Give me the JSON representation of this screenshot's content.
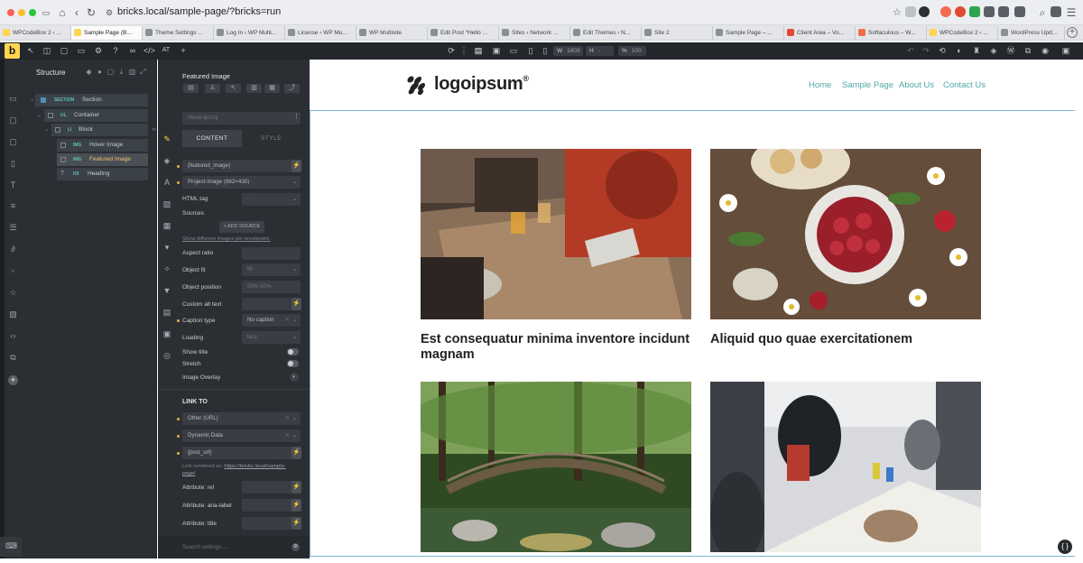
{
  "browser": {
    "url": "bricks.local/sample-page/?bricks=run",
    "tabs": [
      "WPCodeBox 2 ‹ ...",
      "Sample Page (B...",
      "Theme Settings ...",
      "Log In ‹ WP Multi...",
      "License ‹ WP Mu...",
      "WP Multisite",
      "Edit Post “Hello ...",
      "Sites ‹ Network ...",
      "Edit Themes ‹ N...",
      "Site 2",
      "Sample Page – ...",
      "Client Area – Vo...",
      "Softaculous – W...",
      "WPCodeBox 2 ‹ ...",
      "WordPress Upd..."
    ]
  },
  "toolbar": {
    "logo": "b",
    "at_label": "AT",
    "width_label": "W",
    "width_value": "1809",
    "height_label": "H",
    "height_value": "-",
    "zoom_label": "%",
    "zoom_value": "100"
  },
  "structure": {
    "title": "Structure",
    "nodes": [
      {
        "tag": "SECTION",
        "label": "Section"
      },
      {
        "tag": "UL",
        "label": "Container"
      },
      {
        "tag": "LI",
        "label": "Block"
      },
      {
        "tag": "IMG",
        "label": "Hover Image"
      },
      {
        "tag": "IMG",
        "label": "Featured Image"
      },
      {
        "tag": "H3",
        "label": "Heading"
      }
    ]
  },
  "settings": {
    "title": "Featured Image",
    "css_id": "#brxe-lpzsnj",
    "tab_content": "CONTENT",
    "tab_style": "STYLE",
    "image_value": "{featured_image}",
    "image_size": "Project-image (682×430)",
    "html_tag_label": "HTML tag",
    "html_tag_value": "-",
    "sources_label": "Sources",
    "add_source": "+ ADD SOURCE",
    "show_different": "Show different images per breakpoint.",
    "aspect_ratio_label": "Aspect ratio",
    "object_fit_label": "Object fit",
    "object_fit_value": "fill",
    "object_position_label": "Object position",
    "object_position_value": "50% 50%",
    "custom_alt_label": "Custom alt text",
    "caption_type_label": "Caption type",
    "caption_type_value": "No caption",
    "loading_label": "Loading",
    "loading_value": "lazy",
    "show_title_label": "Show title",
    "stretch_label": "Stretch",
    "image_overlay_label": "Image Overlay",
    "link_to_heading": "LINK TO",
    "link_type": "Other (URL)",
    "link_dynamic": "Dynamic Data",
    "link_value": "{post_url}",
    "link_rendered_prefix": "Link rendered as:",
    "link_rendered_url": "https://bricks.local/sample-page/",
    "attr_rel": "Attribute: rel",
    "attr_aria": "Attribute: aria-label",
    "attr_title": "Attribute: title",
    "search_placeholder": "Search settings ..."
  },
  "site": {
    "logo_text": "logoipsum",
    "logo_mark": "®",
    "nav": [
      "Home",
      "Sample Page",
      "About Us",
      "Contact Us"
    ],
    "cards": [
      {
        "title": "Est consequatur minima inventore incidunt magnam"
      },
      {
        "title": "Aliquid quo quae exercitationem"
      }
    ]
  },
  "colors": {
    "accent": "#ffd64f",
    "nav_link": "#4fa6a6",
    "panel_bg": "#2b2e33",
    "canvas_outline": "#7fb4d8"
  }
}
